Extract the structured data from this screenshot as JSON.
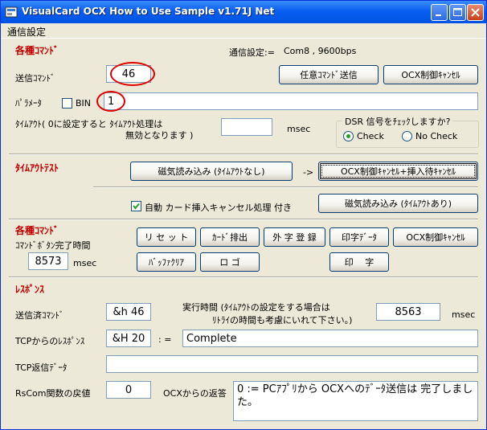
{
  "window": {
    "title": "VisualCard OCX How to Use Sample v1.71J Net"
  },
  "menu": {
    "item": "通信設定"
  },
  "commands": {
    "heading": "各種ｺﾏﾝﾄﾞ",
    "comm_status_label": "通信設定:=",
    "comm_status_value": "Com8 , 9600bps",
    "send_command_label": "送信ｺﾏﾝﾄﾞ",
    "send_command_value": "46",
    "any_command_button": "任意ｺﾏﾝﾄﾞ送信",
    "ocx_cancel_button": "OCX制御ｷｬﾝｾﾙ",
    "param_label": "ﾊﾟﾗﾒｰﾀ",
    "bin_label": "BIN",
    "param_value": "1",
    "timeout_label_1": "ﾀｲﾑｱｳﾄ( 0に設定すると ﾀｲﾑｱｳﾄ処理は",
    "timeout_label_2": "無効となります )",
    "timeout_value": "",
    "msec": "msec",
    "dsr_group_title": "DSR 信号をﾁｪｯｸしますか?",
    "dsr_check": "Check",
    "dsr_no_check": "No Check"
  },
  "timeout_test": {
    "heading": "ﾀｲﾑｱｳﾄﾃｽﾄ",
    "magnetic_read_no_timeout": "磁気読み込み (ﾀｲﾑｱｳﾄなし)",
    "arrow": "->",
    "cancel_insert_wait": "OCX制御ｷｬﾝｾﾙ+挿入待ｷｬﾝｾﾙ",
    "auto_cancel_label": "自動 カード挿入キャンセル処理 付き",
    "magnetic_read_with_timeout": "磁気読み込み (ﾀｲﾑｱｳﾄあり)"
  },
  "various": {
    "heading": "各種ｺﾏﾝﾄﾞ",
    "complete_time_label": "ｺﾏﾝﾄﾞﾎﾞﾀﾝ完了時間",
    "complete_time_value": "8573",
    "msec": "msec",
    "reset": "リ セ ッ ト",
    "card_eject": "ｶｰﾄﾞ排出",
    "gaiji_register": "外 字 登 録",
    "print_data": "印字ﾃﾞｰﾀ",
    "ocx_cancel": "OCX制御ｷｬﾝｾﾙ",
    "buffer_clear": "ﾊﾞｯﾌｧｸﾘｱ",
    "logo": "ロ ゴ",
    "print": "印　 字"
  },
  "response": {
    "heading": "ﾚｽﾎﾟﾝｽ",
    "sent_command_label": "送信済ｺﾏﾝﾄﾞ",
    "sent_command_value": "&h 46",
    "exec_time_label_1": "実行時間 (ﾀｲﾑｱｳﾄの設定をする場合は",
    "exec_time_label_2": "ﾘﾄﾗｲの時間も考慮にいれて下さい。)",
    "exec_time_value": "8563",
    "msec": "msec",
    "tcp_response_label": "TCPからのﾚｽﾎﾟﾝｽ",
    "tcp_response_code": "&H 20",
    "assign": ": =",
    "tcp_response_text": "Complete",
    "tcp_return_data_label": "TCP返信ﾃﾞｰﾀ",
    "tcp_return_data_value": "",
    "rscom_label": "RsCom関数の戻値",
    "rscom_value": "0",
    "ocx_return_label": "OCXからの返答",
    "ocx_return_value": "0 := PCｱﾌﾟﾘから OCXへのﾃﾞｰﾀ送信は 完了しました。"
  },
  "colors": {
    "heading": "#c00000",
    "annotation_circle": "#e00000",
    "title_bar": "#0054e3"
  }
}
